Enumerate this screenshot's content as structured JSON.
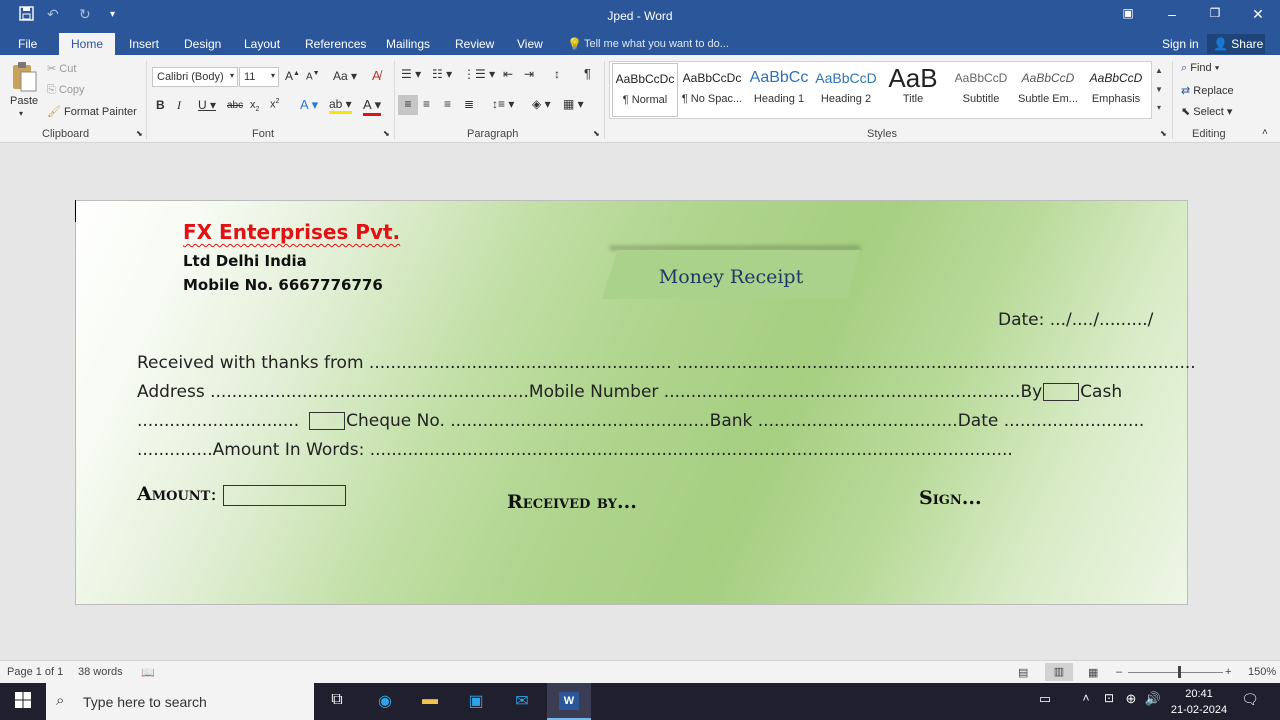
{
  "titlebar": {
    "title": "Jped  -  Word",
    "save_icon": "save-icon",
    "undo_icon": "undo-icon",
    "redo_icon": "redo-icon"
  },
  "tabs": [
    "File",
    "Home",
    "Insert",
    "Design",
    "Layout",
    "References",
    "Mailings",
    "Review",
    "View"
  ],
  "tell_me": "Tell me what you want to do...",
  "sign_in": "Sign in",
  "share": "Share",
  "clipboard": {
    "paste": "Paste",
    "cut": "Cut",
    "copy": "Copy",
    "format_painter": "Format Painter",
    "label": "Clipboard"
  },
  "font": {
    "name": "Calibri (Body)",
    "size": "11",
    "label": "Font"
  },
  "paragraph": {
    "label": "Paragraph"
  },
  "styles": {
    "label": "Styles",
    "items": [
      {
        "sample": "AaBbCcDc",
        "name": "¶ Normal"
      },
      {
        "sample": "AaBbCcDc",
        "name": "¶ No Spac..."
      },
      {
        "sample": "AaBbCc",
        "name": "Heading 1"
      },
      {
        "sample": "AaBbCcD",
        "name": "Heading 2"
      },
      {
        "sample": "AaB",
        "name": "Title"
      },
      {
        "sample": "AaBbCcD",
        "name": "Subtitle"
      },
      {
        "sample": "AaBbCcD",
        "name": "Subtle Em..."
      },
      {
        "sample": "AaBbCcD",
        "name": "Emphasis"
      }
    ]
  },
  "editing": {
    "find": "Find",
    "replace": "Replace",
    "select": "Select",
    "label": "Editing"
  },
  "document": {
    "company": "FX Enterprises Pvt.",
    "line2": "Ltd Delhi India",
    "line3": "Mobile No.  6667776776",
    "receipt_title": "Money Receipt",
    "date": "Date: .../..../........./",
    "received": "Received with thanks from ........................................................  ................................................................................................",
    "address_a": "Address ...........................................................Mobile Number ..................................................................By",
    "address_b": "Cash",
    "cheque_a": "..............................",
    "cheque_b": "Cheque No. ................................................Bank .....................................Date ..........................",
    "words": "..............Amount In Words: .......................................................................................................................",
    "amount": "Amount",
    "received_by": "Received by...",
    "sign": "Sign..."
  },
  "status": {
    "page": "Page 1 of 1",
    "words": "38 words",
    "zoom": "150%"
  },
  "taskbar": {
    "search": "Type here to search",
    "time": "20:41",
    "date": "21-02-2024"
  }
}
